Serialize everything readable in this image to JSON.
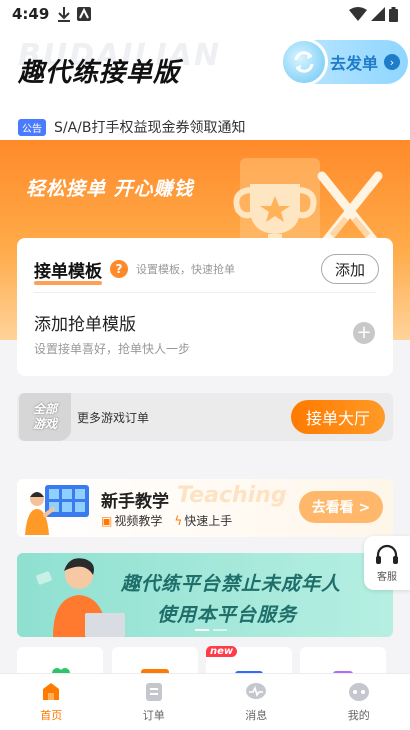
{
  "status_bar": {
    "time": "4:49"
  },
  "header": {
    "watermark": "BUDAILIAN",
    "title": "趣代练接单版",
    "publish_button": "去发单",
    "notice_tag": "公告",
    "notice_text": "S/A/B打手权益现金券领取通知"
  },
  "banner": {
    "slogan": "轻松接单  开心赚钱"
  },
  "template_card": {
    "title": "接单模板",
    "hint": "设置模板，快速抢单",
    "add_button": "添加",
    "add_title": "添加抢单模版",
    "add_subtitle": "设置接单喜好，抢单快人一步"
  },
  "more_orders": {
    "badge_line1": "全部",
    "badge_line2": "游戏",
    "text": "更多游戏订单",
    "hall_button": "接单大厅"
  },
  "tutorial": {
    "title": "新手教学",
    "bg_word": "Teaching",
    "item1": "视频教学",
    "item2": "快速上手",
    "button": "去看看 >"
  },
  "service": {
    "label": "客服"
  },
  "promo": {
    "line1": "趣代练平台禁止未成年人",
    "line2": "使用本平台服务"
  },
  "new_badge": "new",
  "tabs": [
    {
      "label": "首页",
      "active": true
    },
    {
      "label": "订单",
      "active": false
    },
    {
      "label": "消息",
      "active": false
    },
    {
      "label": "我的",
      "active": false
    }
  ],
  "colors": {
    "accent": "#ff7a00",
    "banner_top": "#ff8a2a",
    "promo_text": "#1f6e6a"
  }
}
